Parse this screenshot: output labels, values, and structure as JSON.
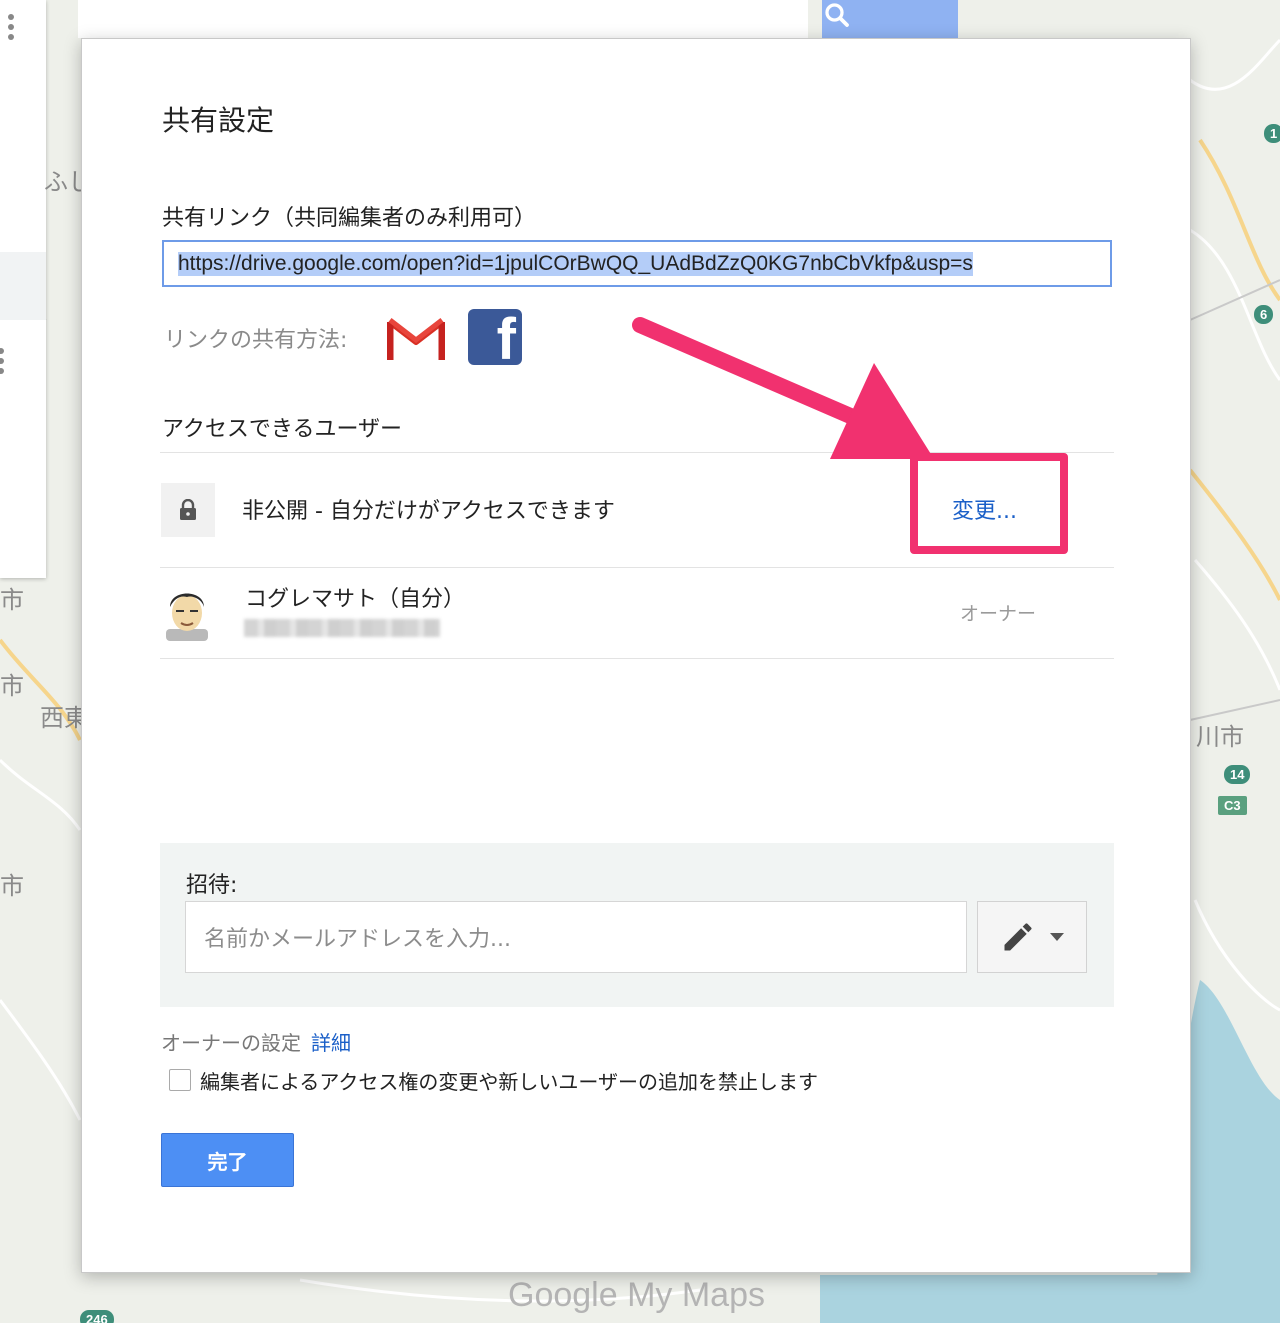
{
  "dialog": {
    "title": "共有設定",
    "share_link_label": "共有リンク（共同編集者のみ利用可）",
    "share_link_url": "https://drive.google.com/open?id=1jpulCOrBwQQ_UAdBdZzQ0KG7nbCbVkfp&usp=s",
    "share_method_label": "リンクの共有方法:",
    "share_icons": [
      "gmail-icon",
      "facebook-icon"
    ],
    "access_heading": "アクセスできるユーザー",
    "visibility": {
      "text": "非公開 - 自分だけがアクセスできます",
      "change_label": "変更..."
    },
    "owner_row": {
      "name": "コグレマサト（自分）",
      "role": "オーナー"
    },
    "invite": {
      "label": "招待:",
      "placeholder": "名前かメールアドレスを入力..."
    },
    "owner_settings": {
      "label": "オーナーの設定",
      "details_link": "詳細",
      "restrict_checkbox_label": "編集者によるアクセス権の変更や新しいユーザーの追加を禁止します",
      "restrict_checked": false
    },
    "done_label": "完了"
  },
  "map": {
    "labels": [
      "ふし",
      "市",
      "市",
      "西東",
      "市",
      "川市"
    ],
    "road_badges": [
      "6",
      "14",
      "C3",
      "1",
      "246"
    ],
    "brand": "Google My Maps"
  },
  "colors": {
    "link_blue": "#1a5fc8",
    "primary_button": "#4d8ff4",
    "annotation_pink": "#f1316f"
  }
}
